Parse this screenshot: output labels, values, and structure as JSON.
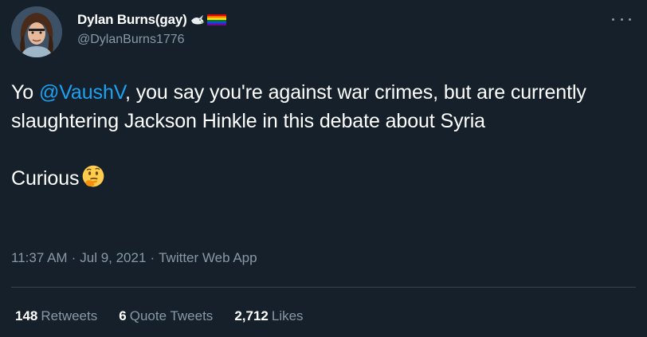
{
  "author": {
    "display_name": "Dylan Burns(gay)",
    "handle": "@DylanBurns1776",
    "badges": [
      "dove-emoji",
      "rainbow-flag-emoji"
    ]
  },
  "tweet": {
    "prefix": "Yo ",
    "mention": "@VaushV",
    "body": ", you say you're against war crimes, but are currently slaughtering Jackson Hinkle in this debate about Syria",
    "closing": "Curious",
    "closing_emoji": "thinking-face-emoji"
  },
  "meta": {
    "time": "11:37 AM",
    "separator": "·",
    "date": "Jul 9, 2021",
    "source": "Twitter Web App"
  },
  "stats": {
    "retweets_count": "148",
    "retweets_label": "Retweets",
    "quotes_count": "6",
    "quotes_label": "Quote Tweets",
    "likes_count": "2,712",
    "likes_label": "Likes"
  },
  "colors": {
    "background": "#15202b",
    "text": "#ffffff",
    "secondary": "#8899a6",
    "link": "#1da1f2",
    "divider": "#38444d"
  }
}
